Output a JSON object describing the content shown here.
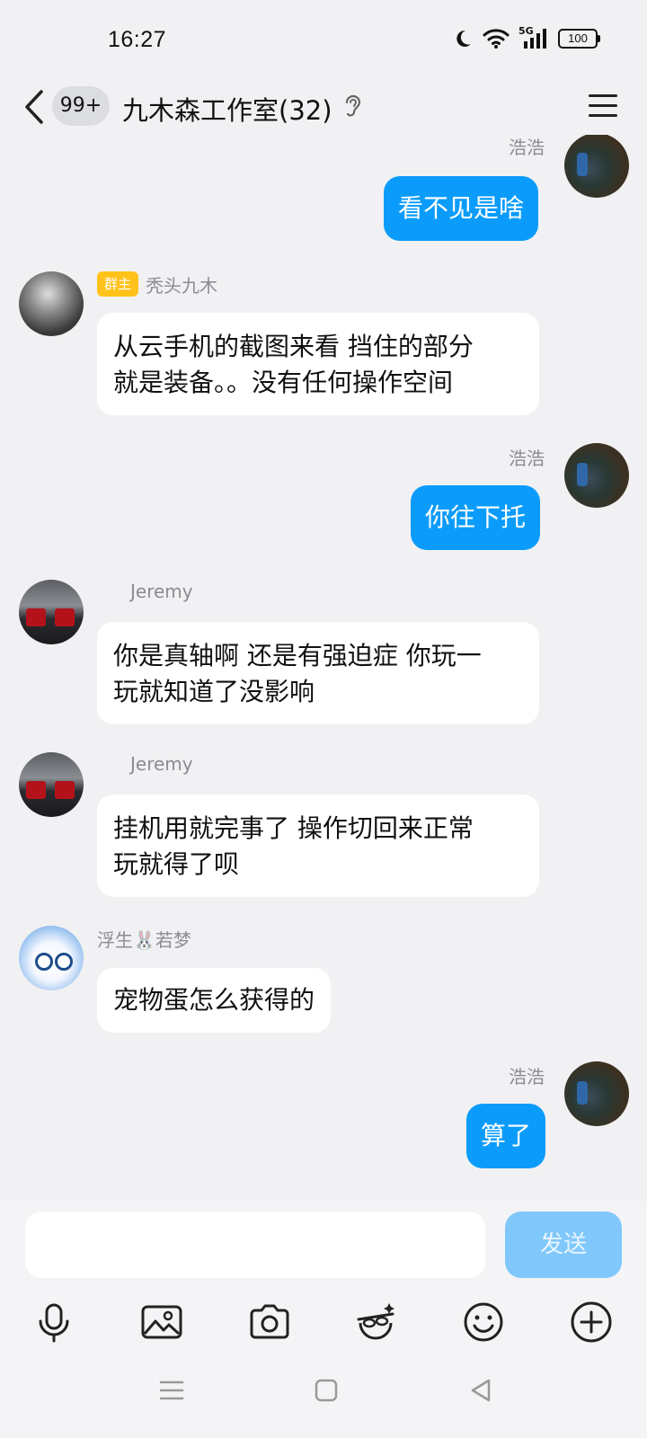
{
  "status_bar": {
    "time": "16:27",
    "network": "5G",
    "battery": "100"
  },
  "header": {
    "unread_badge": "99+",
    "title": "九木森工作室(32)"
  },
  "messages": [
    {
      "sender": "浩浩",
      "text": "看不见是啥",
      "direction": "out"
    },
    {
      "sender": "秃头九木",
      "role": "群主",
      "text_lines": [
        "从云手机的截图来看 挡住的部分",
        "就是装备。。没有任何操作空间"
      ],
      "direction": "in"
    },
    {
      "sender": "浩浩",
      "text": "你往下托",
      "direction": "out"
    },
    {
      "sender": "Jeremy",
      "text_lines": [
        "你是真轴啊 还是有强迫症  你玩一",
        "玩就知道了没影响"
      ],
      "direction": "in"
    },
    {
      "sender": "Jeremy",
      "text_lines": [
        "挂机用就完事了  操作切回来正常",
        "玩就得了呗"
      ],
      "direction": "in"
    },
    {
      "sender": "浮生🐰若梦",
      "text": "宠物蛋怎么获得的",
      "direction": "in"
    },
    {
      "sender": "浩浩",
      "text": "算了",
      "direction": "out"
    }
  ],
  "composer": {
    "input_value": "",
    "send_label": "发送"
  },
  "toolbar_icons": [
    "microphone-icon",
    "image-icon",
    "camera-icon",
    "sticker-icon",
    "emoji-icon",
    "plus-icon"
  ],
  "colors": {
    "outgoing_bubble": "#0b9cfb",
    "send_button": "#80c8fb",
    "role_badge": "#ffc21a"
  }
}
